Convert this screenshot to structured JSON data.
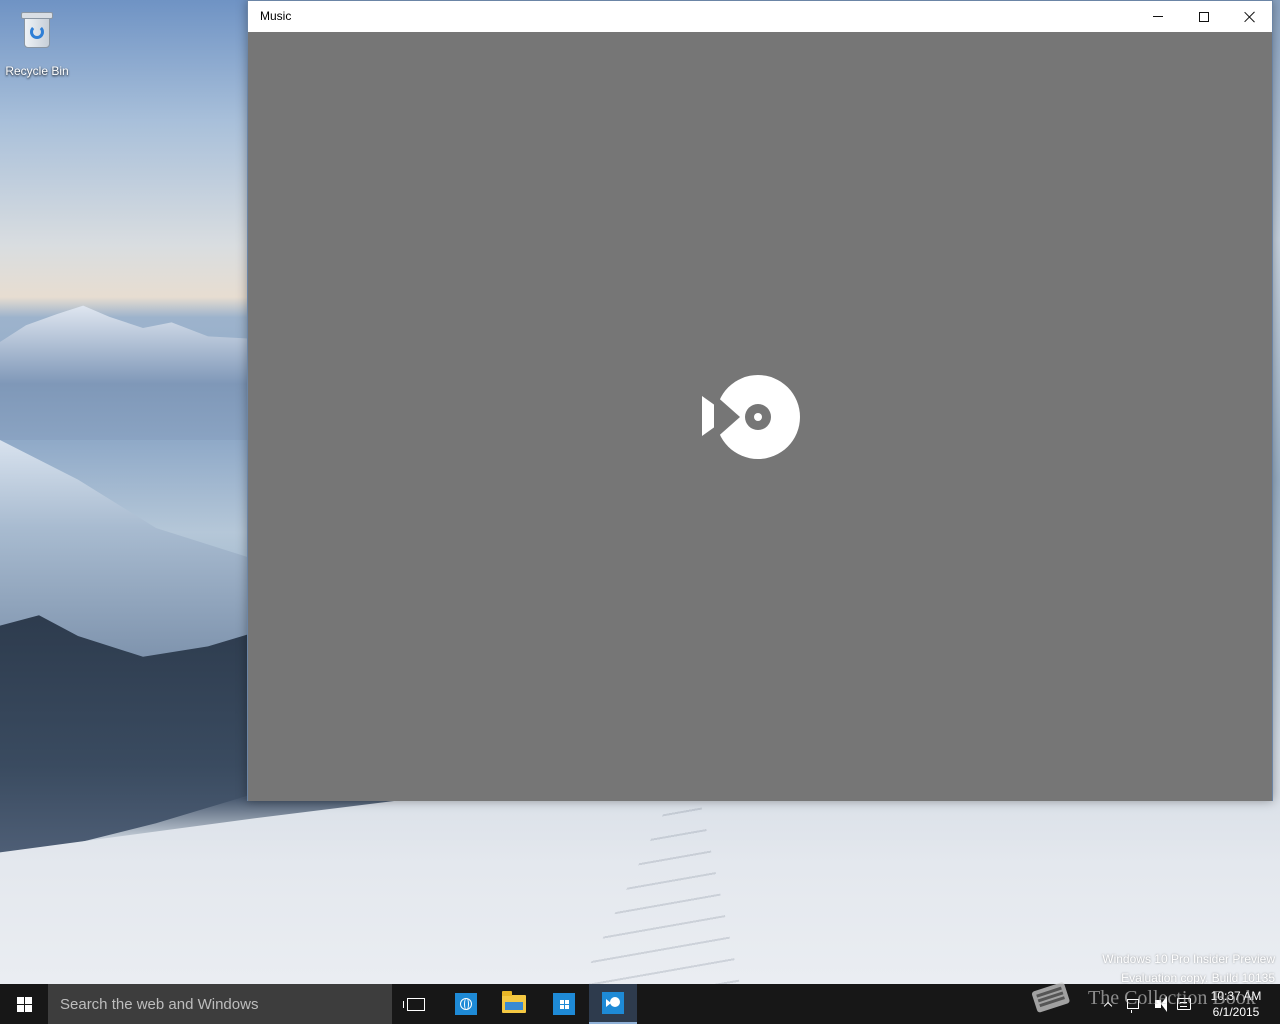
{
  "desktop": {
    "icons": [
      {
        "label": "Recycle Bin",
        "icon": "recycle-bin-icon"
      }
    ],
    "watermark": {
      "line1": "Windows 10 Pro Insider Preview",
      "line2": "Evaluation copy. Build 10135"
    }
  },
  "window": {
    "title": "Music",
    "controls": [
      "minimize",
      "maximize",
      "close"
    ],
    "background_color": "#767676",
    "splash_icon": "music-app-logo-icon"
  },
  "taskbar": {
    "search_placeholder": "Search the web and Windows",
    "pinned": [
      {
        "name": "task-view",
        "icon": "task-view-icon"
      },
      {
        "name": "internet-explorer",
        "icon": "ie-icon"
      },
      {
        "name": "file-explorer",
        "icon": "folder-icon"
      },
      {
        "name": "store",
        "icon": "store-icon"
      },
      {
        "name": "music",
        "icon": "music-icon",
        "active": true
      }
    ],
    "tray": {
      "time": "10:37 AM",
      "date": "6/1/2015"
    },
    "overlay_text": "The Collection Book"
  },
  "colors": {
    "accent": "#1e8ad6",
    "taskbar": "#101010",
    "search_box": "#3d3d3d",
    "active_indicator": "#8fb0d6"
  }
}
